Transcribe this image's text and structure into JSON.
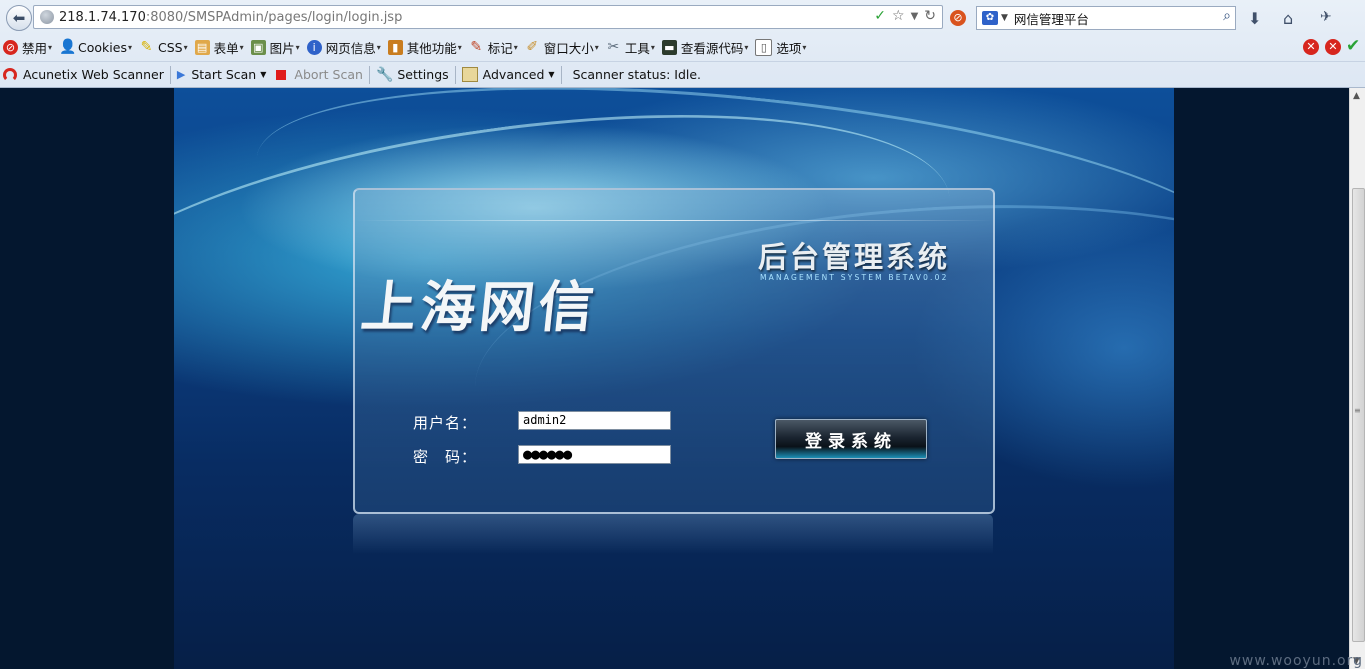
{
  "browser": {
    "url": {
      "host": "218.1.74.170",
      "rest": ":8080/SMSPAdmin/pages/login/login.jsp"
    },
    "search": {
      "value": "网信管理平台"
    }
  },
  "webdev_toolbar": {
    "items": [
      {
        "label": "禁用",
        "icon": "disable-icon",
        "color": "#d7261e"
      },
      {
        "label": "Cookies",
        "icon": "cookie-person-icon",
        "color": "#333333"
      },
      {
        "label": "CSS",
        "icon": "css-pencil-icon",
        "color": "#d8b200"
      },
      {
        "label": "表单",
        "icon": "form-icon",
        "color": "#c2842a"
      },
      {
        "label": "图片",
        "icon": "image-icon",
        "color": "#5a7a3a"
      },
      {
        "label": "网页信息",
        "icon": "info-icon",
        "color": "#2f62c9"
      },
      {
        "label": "其他功能",
        "icon": "book-icon",
        "color": "#c97d1f"
      },
      {
        "label": "标记",
        "icon": "marker-icon",
        "color": "#c0492b"
      },
      {
        "label": "窗口大小",
        "icon": "ruler-icon",
        "color": "#c7902f"
      },
      {
        "label": "工具",
        "icon": "tools-icon",
        "color": "#5a6a7a"
      },
      {
        "label": "查看源代码",
        "icon": "console-icon",
        "color": "#2c3b2c"
      },
      {
        "label": "选项",
        "icon": "options-icon",
        "color": "#6a6a6a"
      }
    ]
  },
  "scanner_toolbar": {
    "brand": "Acunetix Web Scanner",
    "start_scan": "Start Scan",
    "abort_scan": "Abort Scan",
    "settings": "Settings",
    "advanced": "Advanced",
    "status": "Scanner status: Idle."
  },
  "page": {
    "brand_title": "上海网信",
    "system_title": "后台管理系统",
    "system_subtitle": "MANAGEMENT SYSTEM BETAV0.02",
    "username_label": "用户名：",
    "password_label": "密　码：",
    "username_value": "admin2",
    "password_value": "●●●●●●",
    "login_button": "登录系统",
    "bg_color": "#04172f"
  },
  "watermark": "www.wooyun.org"
}
